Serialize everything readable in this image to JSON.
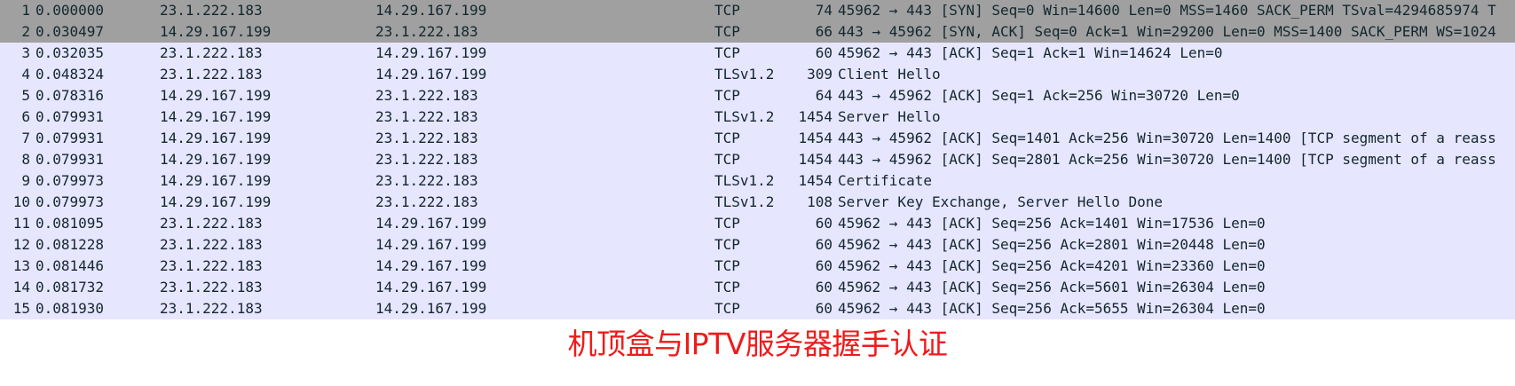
{
  "packets": [
    {
      "no": "1",
      "time": "0.000000",
      "src": "23.1.222.183",
      "dst": "14.29.167.199",
      "proto": "TCP",
      "len": "74",
      "info": "45962 → 443 [SYN] Seq=0 Win=14600 Len=0 MSS=1460 SACK_PERM TSval=4294685974 T",
      "selected": true
    },
    {
      "no": "2",
      "time": "0.030497",
      "src": "14.29.167.199",
      "dst": "23.1.222.183",
      "proto": "TCP",
      "len": "66",
      "info": "443 → 45962 [SYN, ACK] Seq=0 Ack=1 Win=29200 Len=0 MSS=1400 SACK_PERM WS=1024",
      "selected": true
    },
    {
      "no": "3",
      "time": "0.032035",
      "src": "23.1.222.183",
      "dst": "14.29.167.199",
      "proto": "TCP",
      "len": "60",
      "info": "45962 → 443 [ACK] Seq=1 Ack=1 Win=14624 Len=0",
      "selected": false
    },
    {
      "no": "4",
      "time": "0.048324",
      "src": "23.1.222.183",
      "dst": "14.29.167.199",
      "proto": "TLSv1.2",
      "len": "309",
      "info": "Client Hello",
      "selected": false
    },
    {
      "no": "5",
      "time": "0.078316",
      "src": "14.29.167.199",
      "dst": "23.1.222.183",
      "proto": "TCP",
      "len": "64",
      "info": "443 → 45962 [ACK] Seq=1 Ack=256 Win=30720 Len=0",
      "selected": false
    },
    {
      "no": "6",
      "time": "0.079931",
      "src": "14.29.167.199",
      "dst": "23.1.222.183",
      "proto": "TLSv1.2",
      "len": "1454",
      "info": "Server Hello",
      "selected": false
    },
    {
      "no": "7",
      "time": "0.079931",
      "src": "14.29.167.199",
      "dst": "23.1.222.183",
      "proto": "TCP",
      "len": "1454",
      "info": "443 → 45962 [ACK] Seq=1401 Ack=256 Win=30720 Len=1400 [TCP segment of a reass",
      "selected": false
    },
    {
      "no": "8",
      "time": "0.079931",
      "src": "14.29.167.199",
      "dst": "23.1.222.183",
      "proto": "TCP",
      "len": "1454",
      "info": "443 → 45962 [ACK] Seq=2801 Ack=256 Win=30720 Len=1400 [TCP segment of a reass",
      "selected": false
    },
    {
      "no": "9",
      "time": "0.079973",
      "src": "14.29.167.199",
      "dst": "23.1.222.183",
      "proto": "TLSv1.2",
      "len": "1454",
      "info": "Certificate",
      "selected": false
    },
    {
      "no": "10",
      "time": "0.079973",
      "src": "14.29.167.199",
      "dst": "23.1.222.183",
      "proto": "TLSv1.2",
      "len": "108",
      "info": "Server Key Exchange, Server Hello Done",
      "selected": false
    },
    {
      "no": "11",
      "time": "0.081095",
      "src": "23.1.222.183",
      "dst": "14.29.167.199",
      "proto": "TCP",
      "len": "60",
      "info": "45962 → 443 [ACK] Seq=256 Ack=1401 Win=17536 Len=0",
      "selected": false
    },
    {
      "no": "12",
      "time": "0.081228",
      "src": "23.1.222.183",
      "dst": "14.29.167.199",
      "proto": "TCP",
      "len": "60",
      "info": "45962 → 443 [ACK] Seq=256 Ack=2801 Win=20448 Len=0",
      "selected": false
    },
    {
      "no": "13",
      "time": "0.081446",
      "src": "23.1.222.183",
      "dst": "14.29.167.199",
      "proto": "TCP",
      "len": "60",
      "info": "45962 → 443 [ACK] Seq=256 Ack=4201 Win=23360 Len=0",
      "selected": false
    },
    {
      "no": "14",
      "time": "0.081732",
      "src": "23.1.222.183",
      "dst": "14.29.167.199",
      "proto": "TCP",
      "len": "60",
      "info": "45962 → 443 [ACK] Seq=256 Ack=5601 Win=26304 Len=0",
      "selected": false
    },
    {
      "no": "15",
      "time": "0.081930",
      "src": "23.1.222.183",
      "dst": "14.29.167.199",
      "proto": "TCP",
      "len": "60",
      "info": "45962 → 443 [ACK] Seq=256 Ack=5655 Win=26304 Len=0",
      "selected": false
    }
  ],
  "caption": "机顶盒与IPTV服务器握手认证",
  "colors": {
    "row_bg": "#e7e6ff",
    "selected_bg": "#a0a0a0",
    "text": "#12272e",
    "caption": "#ee1b1b"
  }
}
